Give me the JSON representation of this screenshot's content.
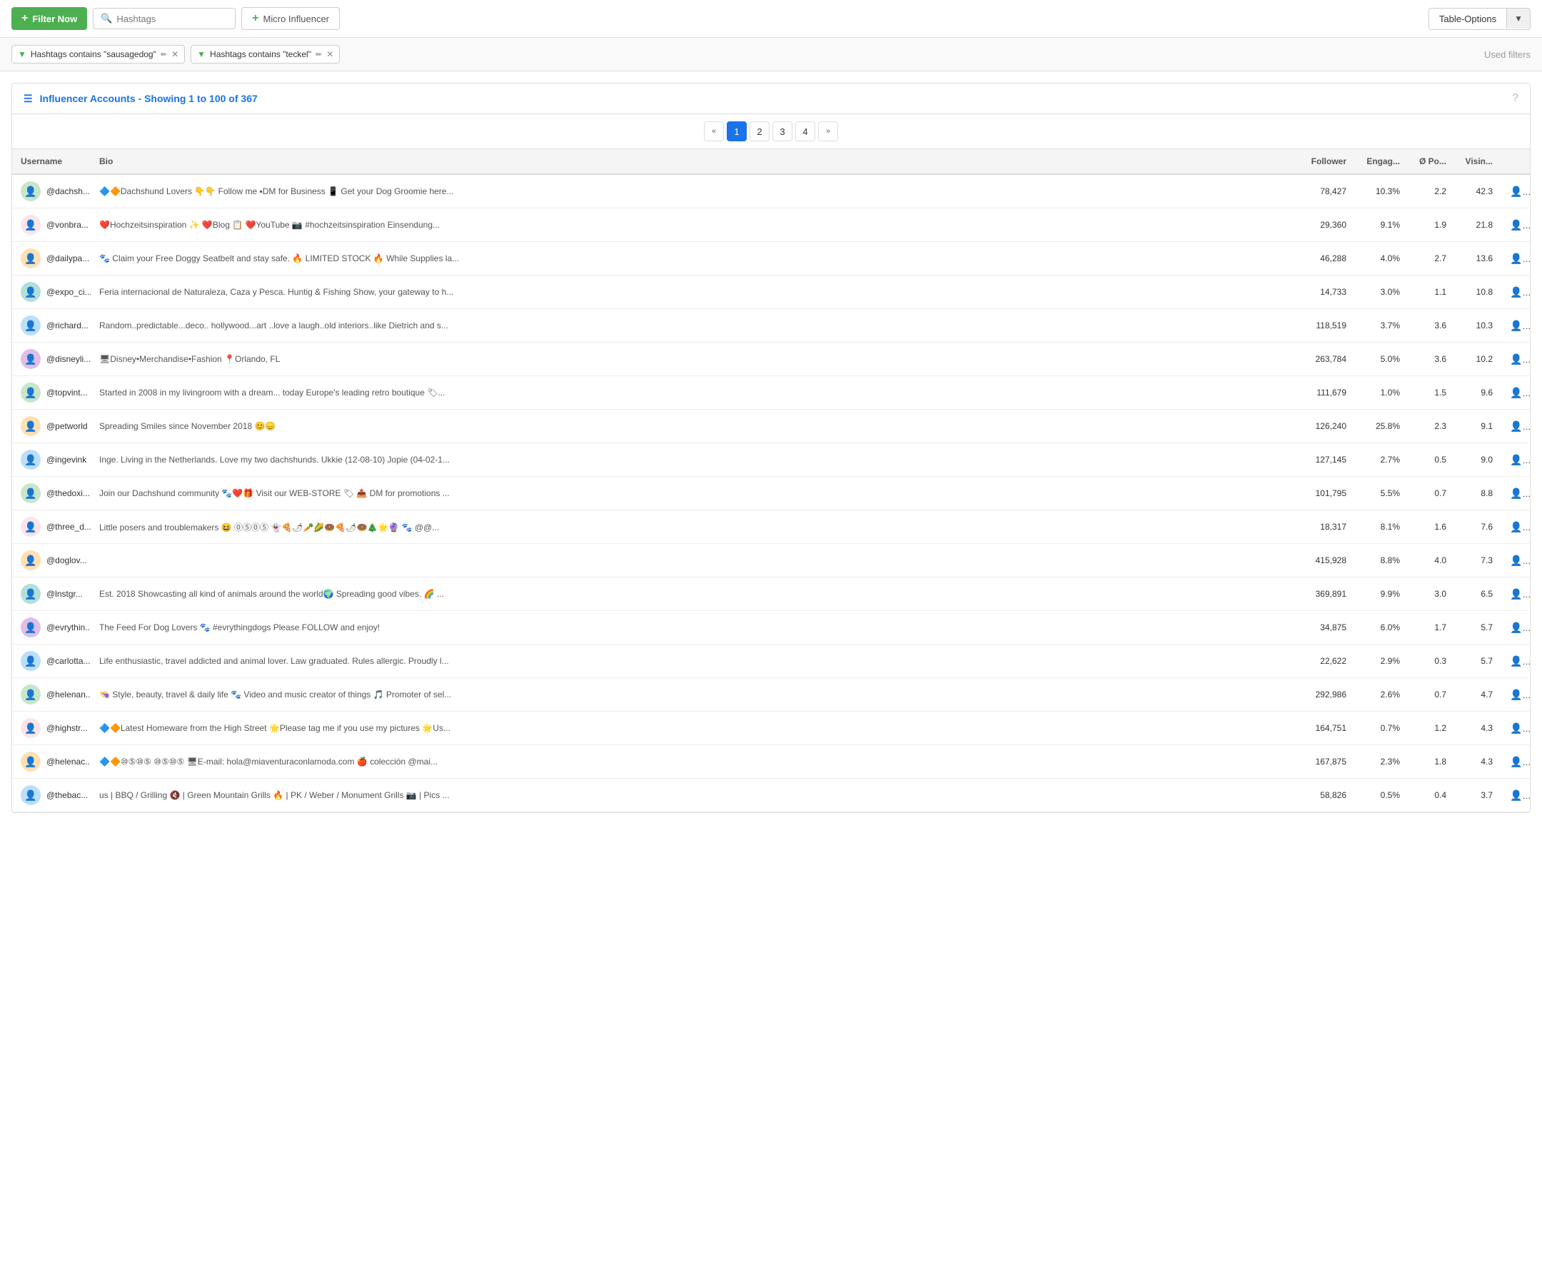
{
  "toolbar": {
    "filter_now_label": "Filter Now",
    "hashtags_placeholder": "Hashtags",
    "micro_influencer_label": "Micro Influencer",
    "table_options_label": "Table-Options"
  },
  "filters": [
    {
      "id": "f1",
      "text": "Hashtags contains \"sausagedog\""
    },
    {
      "id": "f2",
      "text": "Hashtags contains \"teckel\""
    }
  ],
  "used_filters_label": "Used filters",
  "table": {
    "title": "Influencer Accounts - Showing 1 to 100 of 367",
    "columns": [
      "Username",
      "Bio",
      "Follower",
      "Engag...",
      "Ø Po...",
      "Visin..."
    ],
    "pagination": {
      "first": "«",
      "prev": "‹",
      "pages": [
        "1",
        "2",
        "3",
        "4"
      ],
      "active": "1",
      "next": "›",
      "last": "»"
    },
    "rows": [
      {
        "username": "@dachsh...",
        "bio": "🔷🔶Dachshund Lovers 👇👇 Follow me ▪DM for Business 📱 Get your Dog Groomie here...",
        "follower": "78,427",
        "engag": "10.3%",
        "po": "2.2",
        "visin": "42.3",
        "avatar_color": "green"
      },
      {
        "username": "@vonbra...",
        "bio": "❤️Hochzeitsinspiration ✨ ❤️Blog 📋 ❤️YouTube 📷 #hochzeitsinspiration Einsendung...",
        "follower": "29,360",
        "engag": "9.1%",
        "po": "1.9",
        "visin": "21.8",
        "avatar_color": "pink"
      },
      {
        "username": "@dailypa...",
        "bio": "🐾 Claim your Free Doggy Seatbelt and stay safe. 🔥 LIMITED STOCK 🔥 While Supplies la...",
        "follower": "46,288",
        "engag": "4.0%",
        "po": "2.7",
        "visin": "13.6",
        "avatar_color": "orange"
      },
      {
        "username": "@expo_ci...",
        "bio": "Feria internacional de Naturaleza, Caza y Pesca. Huntig & Fishing Show, your gateway to h...",
        "follower": "14,733",
        "engag": "3.0%",
        "po": "1.1",
        "visin": "10.8",
        "avatar_color": "teal"
      },
      {
        "username": "@richard...",
        "bio": "Random..predictable...deco.. hollywood...art ..love a laugh..old interiors..like Dietrich and s...",
        "follower": "118,519",
        "engag": "3.7%",
        "po": "3.6",
        "visin": "10.3",
        "avatar_color": "blue"
      },
      {
        "username": "@disneyli...",
        "bio": "🖥Disney•Merchandise•Fashion 📍Orlando, FL",
        "follower": "263,784",
        "engag": "5.0%",
        "po": "3.6",
        "visin": "10.2",
        "avatar_color": "purple"
      },
      {
        "username": "@topvint...",
        "bio": "Started in 2008 in my livingroom with a dream... today Europe's leading retro boutique 🏷...",
        "follower": "111,679",
        "engag": "1.0%",
        "po": "1.5",
        "visin": "9.6",
        "avatar_color": "green"
      },
      {
        "username": "@petworld",
        "bio": "Spreading Smiles since November 2018 😊😞",
        "follower": "126,240",
        "engag": "25.8%",
        "po": "2.3",
        "visin": "9.1",
        "avatar_color": "orange"
      },
      {
        "username": "@ingevink",
        "bio": "Inge. Living in the Netherlands. Love my two dachshunds. Ukkie (12-08-10) Jopie (04-02-1...",
        "follower": "127,145",
        "engag": "2.7%",
        "po": "0.5",
        "visin": "9.0",
        "avatar_color": "blue"
      },
      {
        "username": "@thedoxi...",
        "bio": "Join our Dachshund community 🐾❤️🎁 Visit our WEB-STORE 🏷 📤 DM for promotions ...",
        "follower": "101,795",
        "engag": "5.5%",
        "po": "0.7",
        "visin": "8.8",
        "avatar_color": "green"
      },
      {
        "username": "@three_d...",
        "bio": "Little posers and troublemakers 😆 ⓪⑤⓪⑤ 👻🍕🌶🥕🌽🍩🍕🌶🍩🎄🌟🔮 🐾 @@...",
        "follower": "18,317",
        "engag": "8.1%",
        "po": "1.6",
        "visin": "7.6",
        "avatar_color": "pink"
      },
      {
        "username": "@doglov...",
        "bio": "",
        "follower": "415,928",
        "engag": "8.8%",
        "po": "4.0",
        "visin": "7.3",
        "avatar_color": "orange"
      },
      {
        "username": "@lnstgr...",
        "bio": "Est. 2018 Showcasting all kind of animals around the world🌍 Spreading good vibes. 🌈 ...",
        "follower": "369,891",
        "engag": "9.9%",
        "po": "3.0",
        "visin": "6.5",
        "avatar_color": "teal"
      },
      {
        "username": "@evrythin...",
        "bio": "The Feed For Dog Lovers 🐾 #evrythingdogs Please FOLLOW and enjoy!",
        "follower": "34,875",
        "engag": "6.0%",
        "po": "1.7",
        "visin": "5.7",
        "avatar_color": "purple"
      },
      {
        "username": "@carlotta...",
        "bio": "Life enthusiastic, travel addicted and animal lover. Law graduated. Rules allergic. Proudly l...",
        "follower": "22,622",
        "engag": "2.9%",
        "po": "0.3",
        "visin": "5.7",
        "avatar_color": "blue"
      },
      {
        "username": "@helenan...",
        "bio": "👒 Style, beauty, travel & daily life 🐾 Video and music creator of things 🎵 Promoter of sel...",
        "follower": "292,986",
        "engag": "2.6%",
        "po": "0.7",
        "visin": "4.7",
        "avatar_color": "green"
      },
      {
        "username": "@highstr...",
        "bio": "🔷🔶Latest Homeware from the High Street 🌟Please tag me if you use my pictures 🌟Us...",
        "follower": "164,751",
        "engag": "0.7%",
        "po": "1.2",
        "visin": "4.3",
        "avatar_color": "pink"
      },
      {
        "username": "@helenac...",
        "bio": "🔷🔶⑩⑤⑩⑤ ⑩⑤⑩⑤ 🖥E-mail: hola@miaventuraconlamoda.com 🍎 colección @mai...",
        "follower": "167,875",
        "engag": "2.3%",
        "po": "1.8",
        "visin": "4.3",
        "avatar_color": "orange"
      },
      {
        "username": "@thebac...",
        "bio": "us | BBQ / Grilling 🔇 | Green Mountain Grills 🔥 | PK / Weber / Monument Grills 📷 | Pics ...",
        "follower": "58,826",
        "engag": "0.5%",
        "po": "0.4",
        "visin": "3.7",
        "avatar_color": "blue"
      }
    ]
  }
}
